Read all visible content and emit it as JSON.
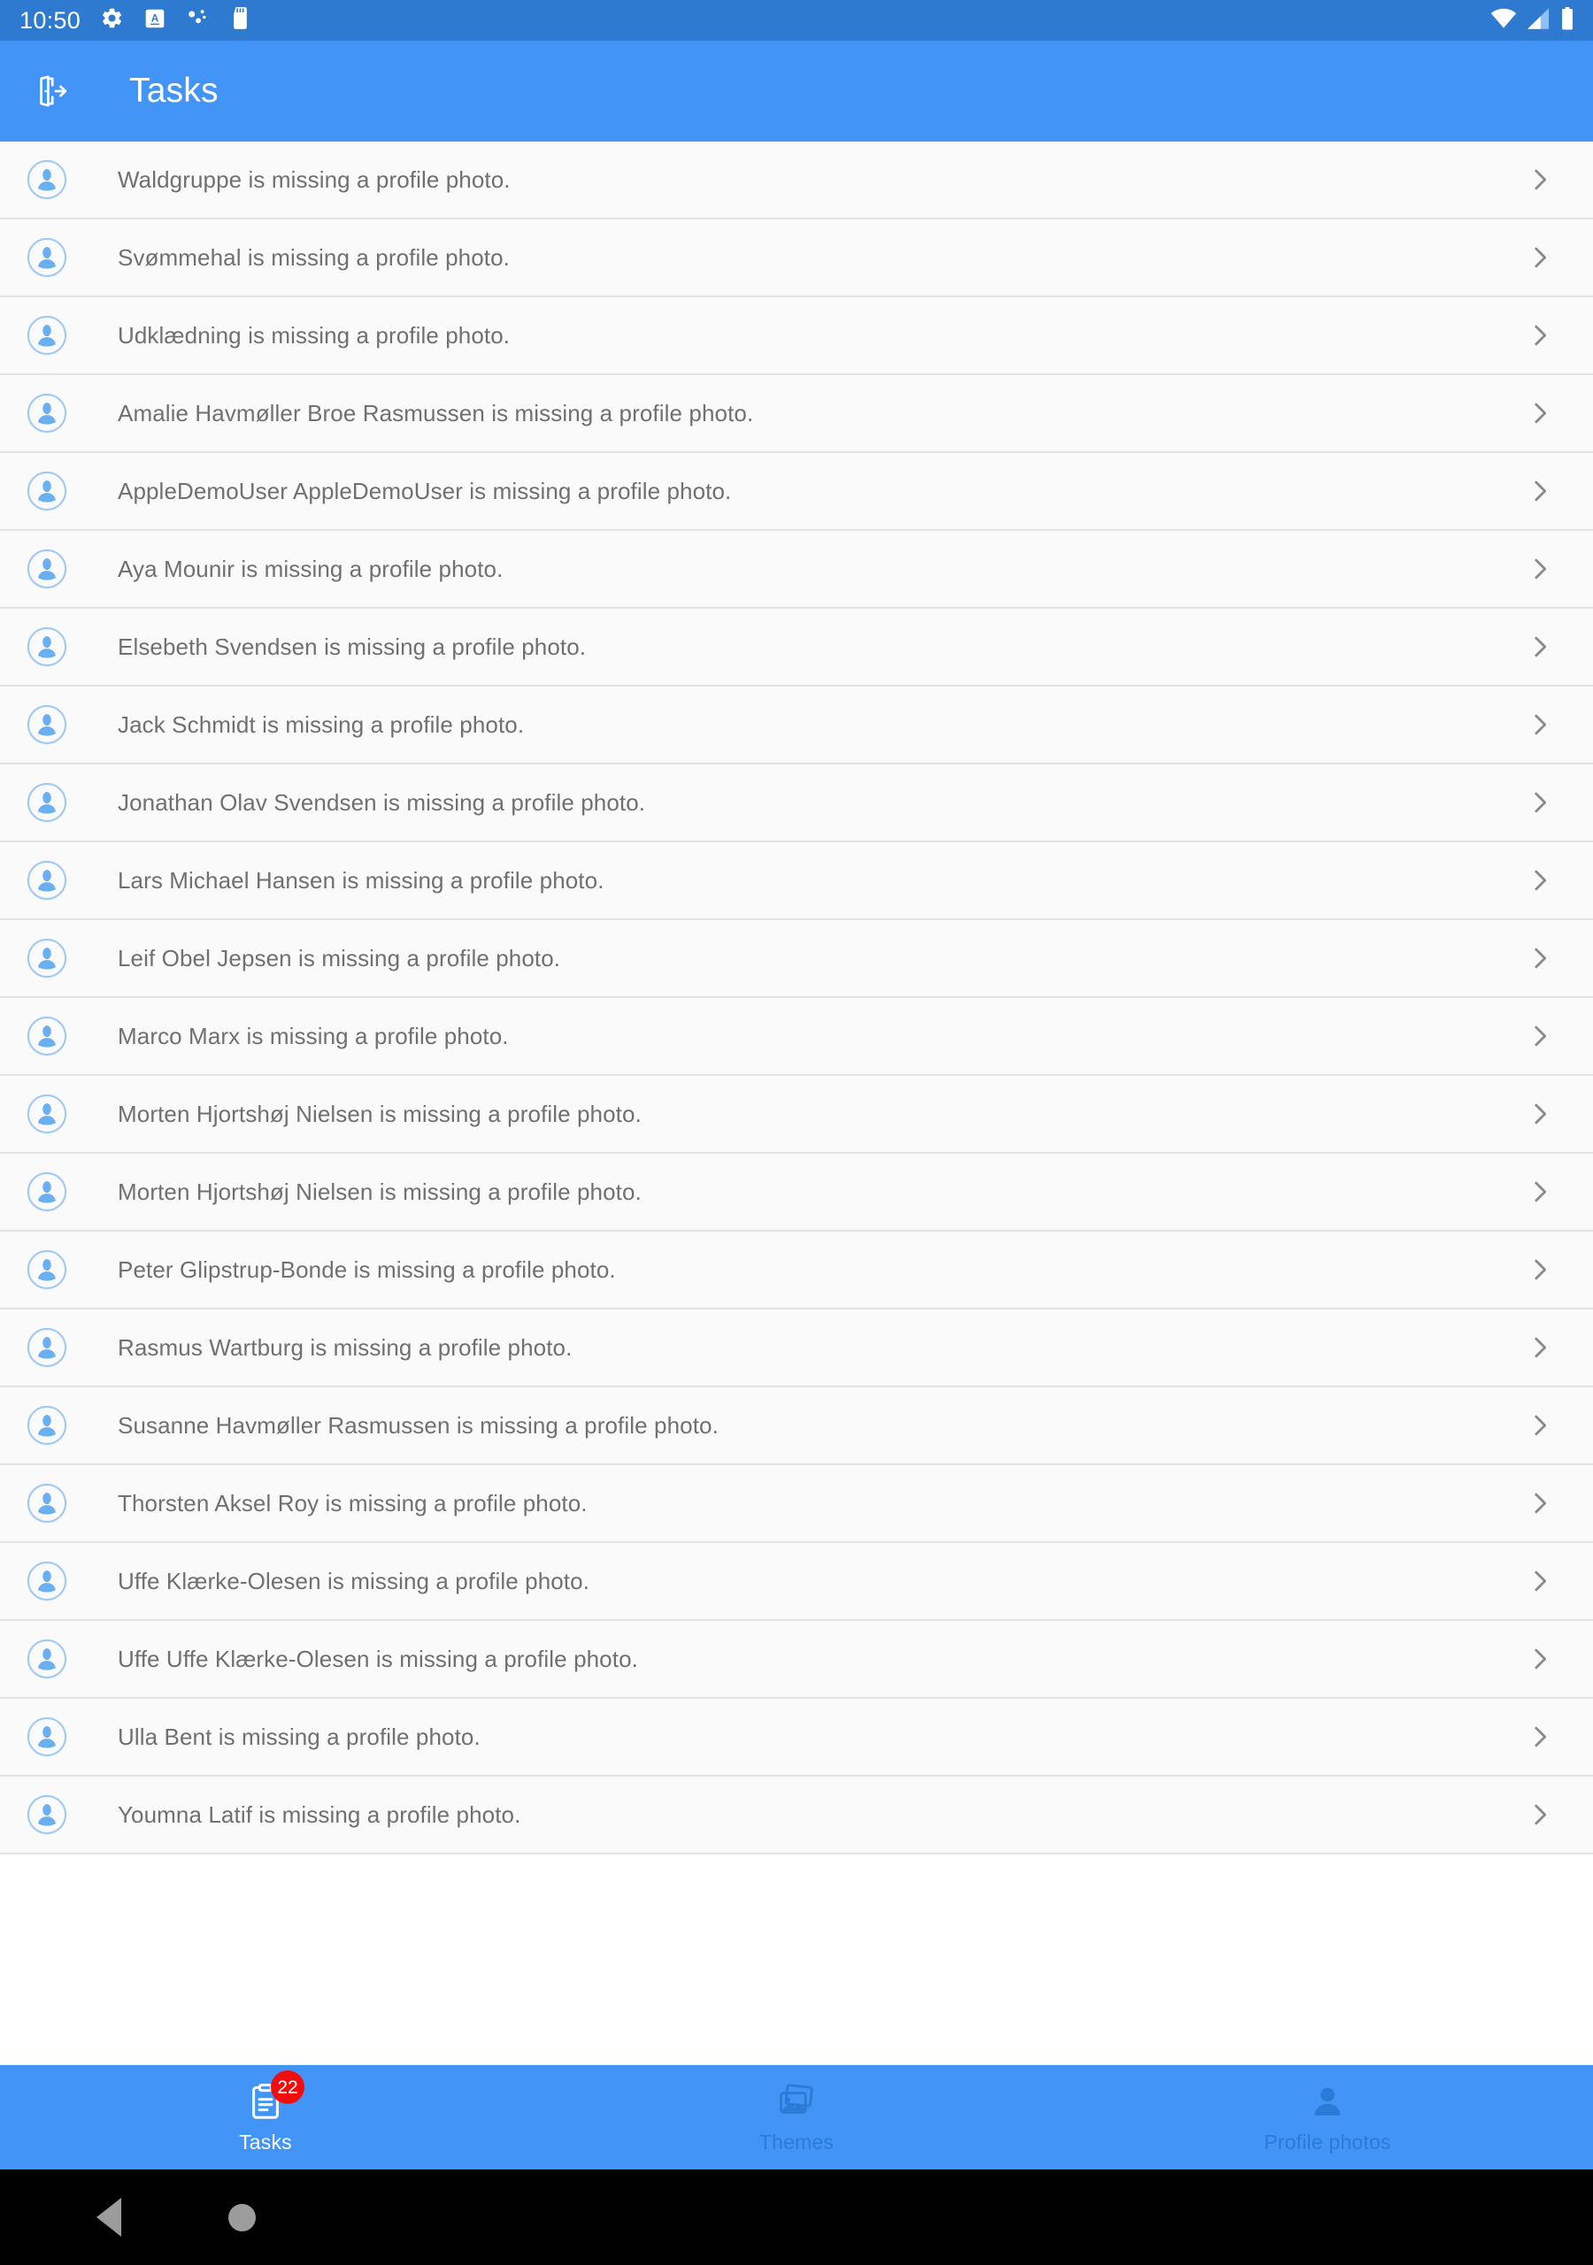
{
  "status_bar": {
    "time": "10:50",
    "icons": [
      "gear-icon",
      "keyboard-language-icon",
      "bluetooth-dots-icon",
      "sd-card-icon"
    ],
    "right_icons": [
      "wifi-icon",
      "cellular-signal-icon",
      "battery-icon"
    ],
    "background": "#2f7ad1"
  },
  "app_bar": {
    "title": "Tasks",
    "leading_icon": "logout-icon",
    "background": "#4294f7"
  },
  "tasks": [
    {
      "text": "Waldgruppe is missing a profile photo."
    },
    {
      "text": "Svømmehal is missing a profile photo."
    },
    {
      "text": "Udklædning is missing a profile photo."
    },
    {
      "text": "Amalie Havmøller Broe Rasmussen is missing a profile photo."
    },
    {
      "text": "AppleDemoUser AppleDemoUser is missing a profile photo."
    },
    {
      "text": "Aya Mounir is missing a profile photo."
    },
    {
      "text": "Elsebeth Svendsen is missing a profile photo."
    },
    {
      "text": "Jack Schmidt is missing a profile photo."
    },
    {
      "text": "Jonathan Olav Svendsen is missing a profile photo."
    },
    {
      "text": "Lars Michael Hansen is missing a profile photo."
    },
    {
      "text": "Leif Obel Jepsen is missing a profile photo."
    },
    {
      "text": "Marco Marx is missing a profile photo."
    },
    {
      "text": "Morten Hjortshøj Nielsen is missing a profile photo."
    },
    {
      "text": "Morten Hjortshøj Nielsen is missing a profile photo."
    },
    {
      "text": "Peter Glipstrup-Bonde is missing a profile photo."
    },
    {
      "text": "Rasmus Wartburg is missing a profile photo."
    },
    {
      "text": "Susanne Havmøller Rasmussen is missing a profile photo."
    },
    {
      "text": "Thorsten Aksel Roy is missing a profile photo."
    },
    {
      "text": "Uffe Klærke-Olesen is missing a profile photo."
    },
    {
      "text": "Uffe Uffe Klærke-Olesen is missing a profile photo."
    },
    {
      "text": "Ulla Bent is missing a profile photo."
    },
    {
      "text": "Youmna Latif is missing a profile photo."
    }
  ],
  "bottom_nav": {
    "tabs": [
      {
        "label": "Tasks",
        "icon": "clipboard-icon",
        "badge": "22",
        "active": true
      },
      {
        "label": "Themes",
        "icon": "images-icon",
        "badge": "",
        "active": false
      },
      {
        "label": "Profile photos",
        "icon": "person-icon",
        "badge": "",
        "active": false
      }
    ],
    "badge_color": "#f20d0d",
    "active_color": "#ffffff",
    "inactive_color": "#2b7ad6"
  },
  "android_nav": {
    "back": "back-triangle-icon",
    "home": "home-circle-icon"
  },
  "colors": {
    "accent": "#4294f7",
    "status_bar": "#2f7ad1",
    "row_bg": "#fafafa",
    "text": "#707070"
  }
}
